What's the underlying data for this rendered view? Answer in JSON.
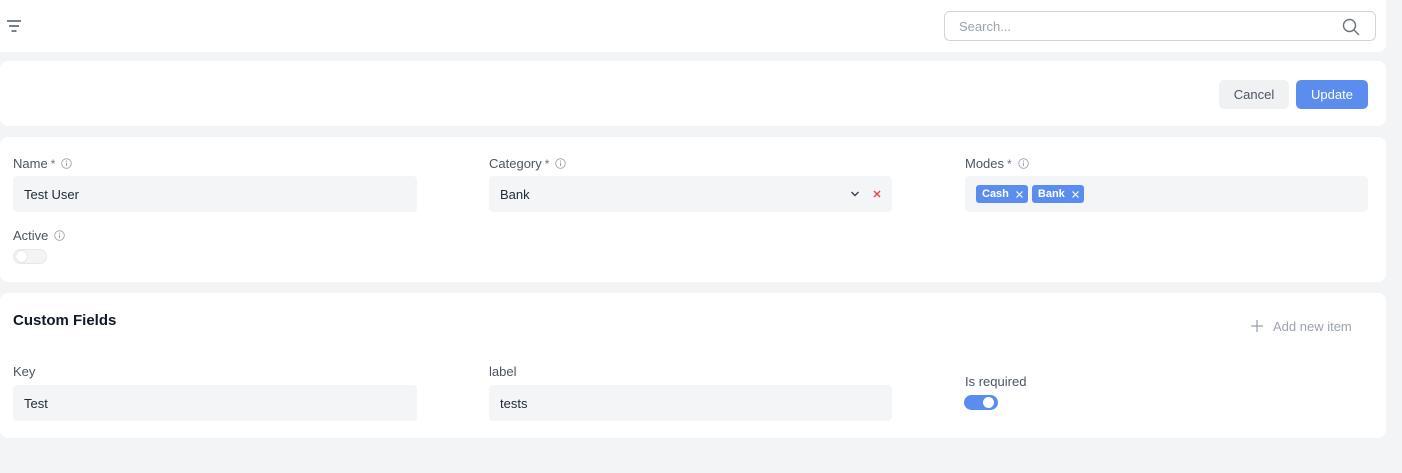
{
  "topbar": {
    "search": {
      "placeholder": "Search...",
      "value": ""
    }
  },
  "actions": {
    "cancel_label": "Cancel",
    "update_label": "Update"
  },
  "form": {
    "name": {
      "label": "Name",
      "required": "*",
      "value": "Test User"
    },
    "category": {
      "label": "Category",
      "required": "*",
      "value": "Bank"
    },
    "modes": {
      "label": "Modes",
      "required": "*",
      "tags": [
        "Cash",
        "Bank"
      ]
    },
    "active": {
      "label": "Active",
      "checked": false
    }
  },
  "custom_fields": {
    "title": "Custom Fields",
    "add_label": "Add new item",
    "items": [
      {
        "key_label": "Key",
        "key_value": "Test",
        "label_label": "label",
        "label_value": "tests",
        "required_label": "Is required",
        "required_checked": true
      }
    ]
  },
  "colors": {
    "accent": "#5b8def",
    "danger": "#ef4444",
    "page_bg": "#f3f4f6"
  }
}
